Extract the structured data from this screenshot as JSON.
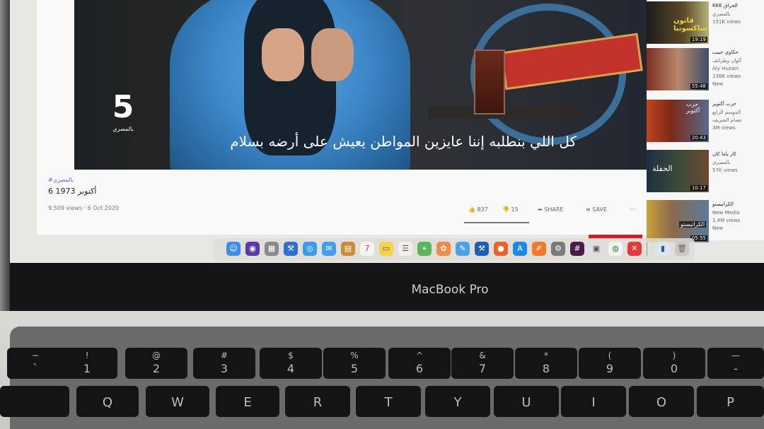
{
  "video": {
    "subtitle": "كل اللي بنطلبه إننا عايزين المواطن يعيش على أرضه بسلام",
    "logo_number": "5",
    "logo_text": "بالمصري"
  },
  "video_info": {
    "channel": "#بالمصري",
    "title": "6 1973 أكتوبر",
    "views_date": "9,509 views · 6 Oct 2020",
    "likes": "837",
    "dislikes": "15",
    "share_label": "SHARE",
    "save_label": "SAVE",
    "more_label": "···"
  },
  "related": [
    {
      "title": "KKK الحراق",
      "channel": "بالمصري",
      "meta": "151K views",
      "duration": "19:19",
      "thumb_text": "قانون ساكسونيا"
    },
    {
      "title": "حكاوي حبيب",
      "channel": "ألوان وطرائف",
      "meta": "Aly Huzain",
      "extra": "138K views",
      "extra2": "New",
      "duration": "55:48"
    },
    {
      "title": "حرب أكتوبر",
      "channel": "الموسم الرابع",
      "meta": "عصام الشريف",
      "extra": "3M views",
      "duration": "20:43",
      "thumb_text": "حرب أكتوبر"
    },
    {
      "title": "كار ياما كان",
      "channel": "بالمصري",
      "meta": "57K views",
      "duration": "10:17",
      "thumb_text": "الحفلة"
    },
    {
      "title": "الكراتيستو",
      "channel": "New Media",
      "meta": "1.4M views",
      "extra": "New",
      "duration": "05:55",
      "thumb_text": "الكراتيستو"
    }
  ],
  "dock": [
    "finder-icon",
    "siri-icon",
    "launchpad-icon",
    "xcode-icon",
    "safari-icon",
    "mail-icon",
    "notes-icon",
    "calendar-icon",
    "stickies-icon",
    "reminders-icon",
    "maps-icon",
    "photos-icon",
    "messages-icon",
    "xcode-alt-icon",
    "firefox-icon",
    "appstore-icon",
    "pages-icon",
    "system-preferences-icon",
    "slack-icon",
    "preview-icon",
    "chrome-icon",
    "close-app-icon",
    "files-icon",
    "trash-icon"
  ],
  "laptop": {
    "brand": "MacBook Pro"
  },
  "keys": {
    "row1": [
      {
        "top": "~",
        "bot": "`"
      },
      {
        "top": "!",
        "bot": "1"
      },
      {
        "top": "@",
        "bot": "2"
      },
      {
        "top": "#",
        "bot": "3"
      },
      {
        "top": "$",
        "bot": "4"
      },
      {
        "top": "%",
        "bot": "5"
      },
      {
        "top": "^",
        "bot": "6"
      },
      {
        "top": "&",
        "bot": "7"
      },
      {
        "top": "*",
        "bot": "8"
      },
      {
        "top": "(",
        "bot": "9"
      },
      {
        "top": ")",
        "bot": "0"
      },
      {
        "top": "—",
        "bot": "-"
      }
    ],
    "row2": [
      "Q",
      "W",
      "E",
      "R",
      "T",
      "Y",
      "U",
      "I",
      "O",
      "P"
    ]
  },
  "colors": {
    "bezel": "#141516",
    "accent_red": "#cc2222",
    "shirt_blue": "#3d88c9",
    "key": "#141414"
  }
}
